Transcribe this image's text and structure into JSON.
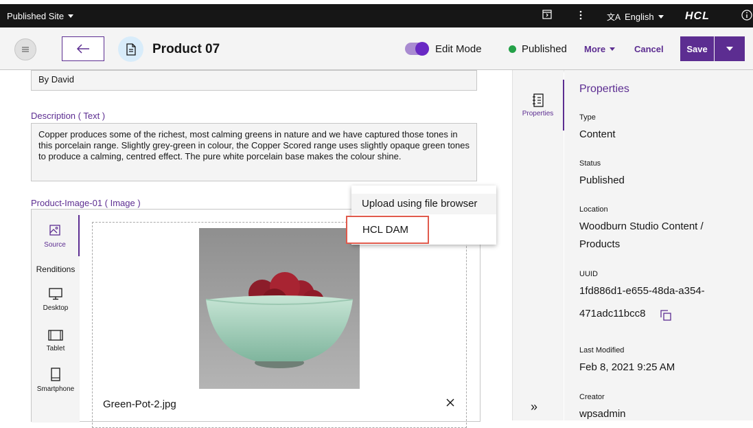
{
  "topbar": {
    "site_label": "Published Site",
    "language": "English",
    "logo": "HCL",
    "icons": [
      "preview-icon",
      "kebab-menu-icon",
      "translate-icon",
      "info-icon"
    ]
  },
  "toolbar": {
    "title": "Product 07",
    "edit_mode_label": "Edit Mode",
    "edit_mode_on": true,
    "status_label": "Published",
    "more_label": "More",
    "cancel_label": "Cancel",
    "save_label": "Save"
  },
  "content": {
    "author_value": "By David",
    "description_label": "Description ( Text )",
    "description_value": "Copper produces some of the richest, most calming greens in nature and we have captured those tones in this porcelain range. Slightly grey-green in colour, the Copper Scored range uses slightly opaque green tones to produce a calming, centred effect. The pure white porcelain base makes the colour shine.",
    "image_field_label": "Product-Image-01 ( Image )",
    "image_nav": {
      "source": "Source",
      "renditions": "Renditions",
      "desktop": "Desktop",
      "tablet": "Tablet",
      "smartphone": "Smartphone"
    },
    "file_name": "Green-Pot-2.jpg"
  },
  "upload_menu": {
    "option_file_browser": "Upload using file browser",
    "option_dam": "HCL DAM"
  },
  "rail": {
    "properties_tab": "Properties"
  },
  "properties": {
    "title": "Properties",
    "type_label": "Type",
    "type_value": "Content",
    "status_label": "Status",
    "status_value": "Published",
    "location_label": "Location",
    "location_value_1": "Woodburn Studio Content /",
    "location_value_2": "Products",
    "uuid_label": "UUID",
    "uuid_value_1": "1fd886d1-e655-48da-a354-",
    "uuid_value_2": "471adc11bcc8",
    "modified_label": "Last Modified",
    "modified_value": "Feb 8, 2021 9:25 AM",
    "creator_label": "Creator",
    "creator_value": "wpsadmin"
  },
  "colors": {
    "accent": "#5c2d91",
    "published": "#24a148",
    "highlight": "#e05a4c"
  }
}
